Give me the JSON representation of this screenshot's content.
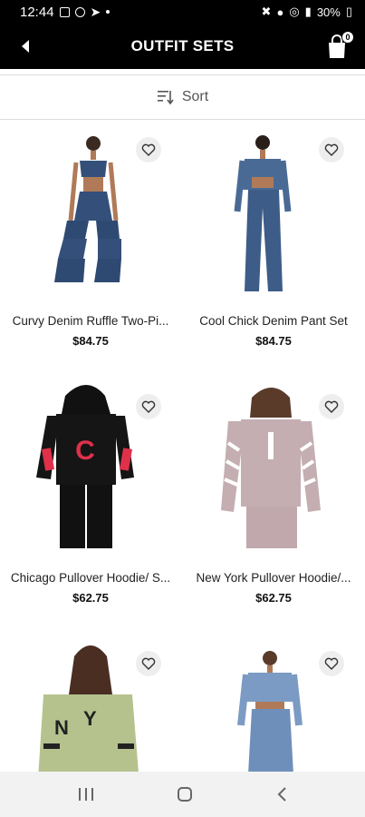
{
  "status_bar": {
    "time": "12:44",
    "battery": "30%"
  },
  "header": {
    "title": "OUTFIT SETS",
    "cart_count": "0"
  },
  "sort": {
    "label": "Sort"
  },
  "products": [
    {
      "name": "Curvy Denim Ruffle Two-Pi...",
      "price": "$84.75"
    },
    {
      "name": "Cool Chick Denim Pant Set",
      "price": "$84.75"
    },
    {
      "name": "Chicago Pullover Hoodie/ S...",
      "price": "$62.75"
    },
    {
      "name": "New York Pullover Hoodie/...",
      "price": "$62.75"
    },
    {
      "name": "",
      "price": ""
    },
    {
      "name": "",
      "price": ""
    }
  ],
  "colors": {
    "header_bg": "#000000",
    "accent_red": "#e0304a",
    "denim": "#34507a"
  },
  "icons": {
    "back": "chevron-left-icon",
    "bag": "shopping-bag-icon",
    "sort": "sort-icon",
    "fav": "heart-icon"
  }
}
